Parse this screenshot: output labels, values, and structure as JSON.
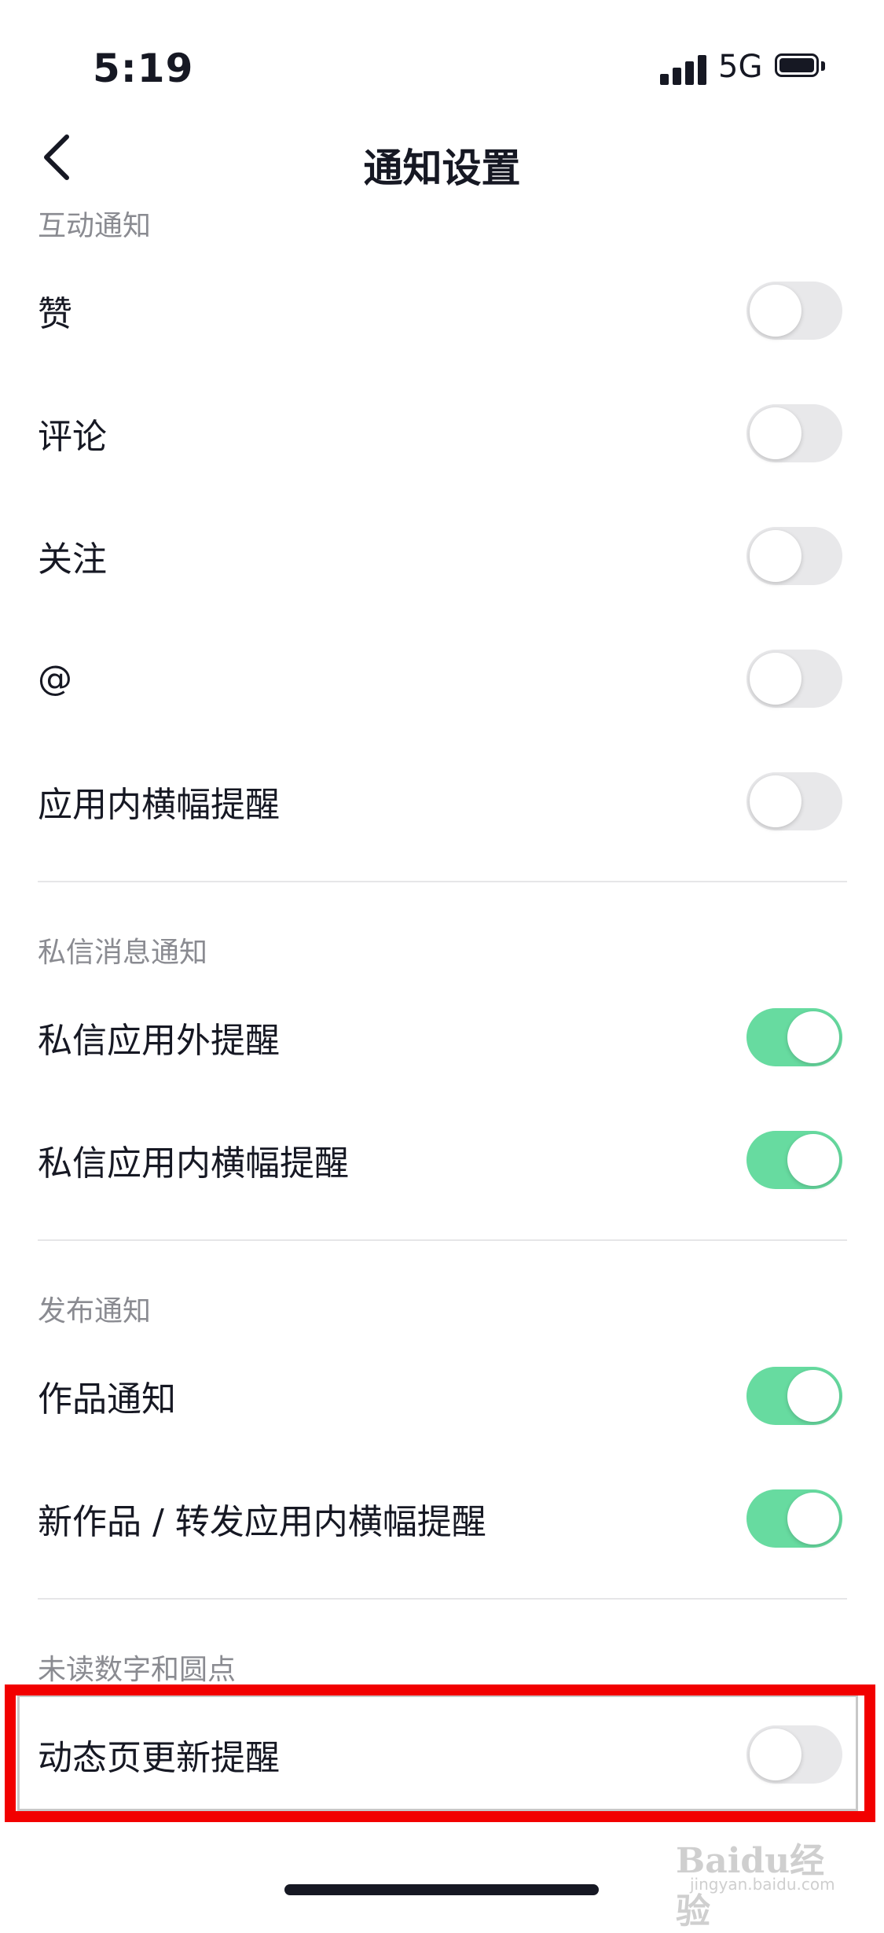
{
  "status_bar": {
    "time": "5:19",
    "network": "5G"
  },
  "header": {
    "title": "通知设置"
  },
  "sections": [
    {
      "title": "互动通知",
      "items": [
        {
          "label": "赞",
          "enabled": false
        },
        {
          "label": "评论",
          "enabled": false
        },
        {
          "label": "关注",
          "enabled": false
        },
        {
          "label": "@",
          "enabled": false
        },
        {
          "label": "应用内横幅提醒",
          "enabled": false
        }
      ]
    },
    {
      "title": "私信消息通知",
      "items": [
        {
          "label": "私信应用外提醒",
          "enabled": true
        },
        {
          "label": "私信应用内横幅提醒",
          "enabled": true
        }
      ]
    },
    {
      "title": "发布通知",
      "items": [
        {
          "label": "作品通知",
          "enabled": true
        },
        {
          "label": "新作品 / 转发应用内横幅提醒",
          "enabled": true
        }
      ]
    },
    {
      "title": "未读数字和圆点",
      "items": [
        {
          "label": "动态页更新提醒",
          "enabled": false
        }
      ]
    }
  ],
  "colors": {
    "toggle_on": "#67dba0",
    "toggle_off": "#e8e8ea",
    "highlight": "#f20000"
  },
  "watermark": {
    "brand": "Baidu经验",
    "url": "jingyan.baidu.com"
  }
}
